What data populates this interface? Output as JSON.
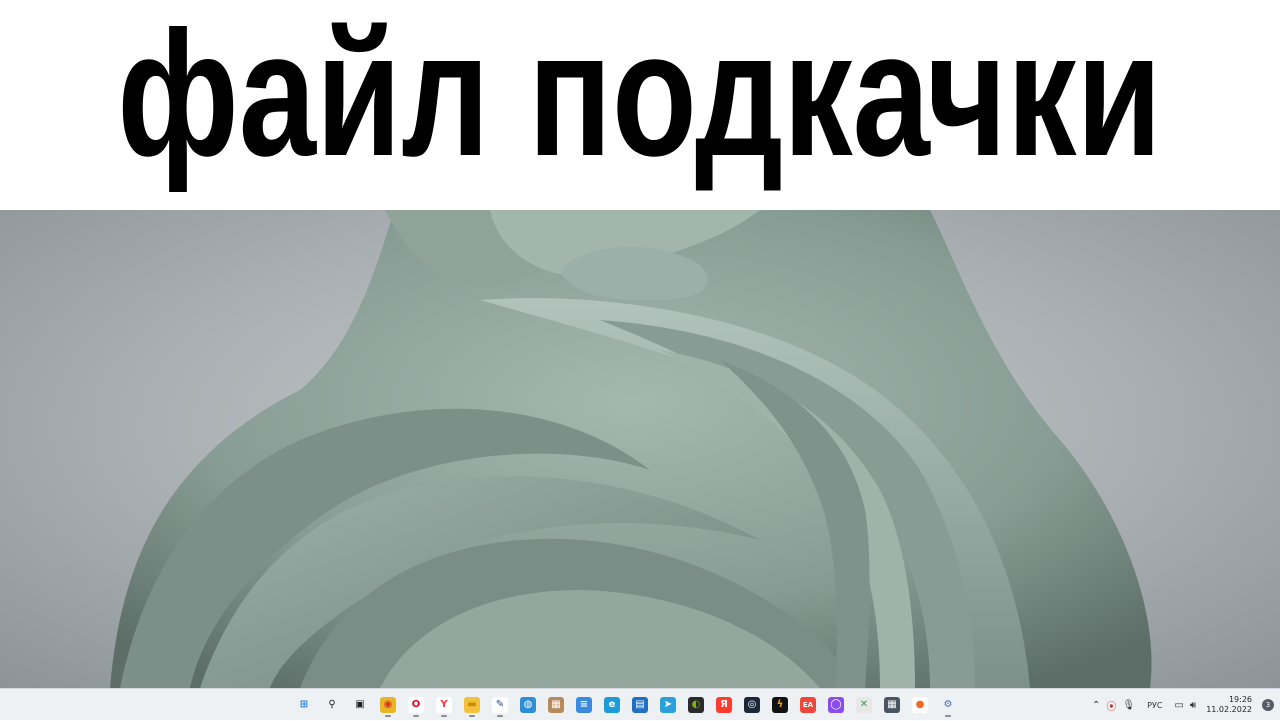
{
  "banner": {
    "title": "файл подкачки"
  },
  "taskbar": {
    "apps": [
      {
        "id": "start-button",
        "icon": "windows-logo",
        "bg": "transparent",
        "glyph": "⊞",
        "color": "#1e7ad8",
        "running": false
      },
      {
        "id": "search-button",
        "icon": "search",
        "bg": "transparent",
        "glyph": "⚲",
        "color": "#202020",
        "running": false
      },
      {
        "id": "task-view-button",
        "icon": "task-view",
        "bg": "transparent",
        "glyph": "▣",
        "color": "#202020",
        "running": false
      },
      {
        "id": "chrome-app",
        "icon": "chrome",
        "bg": "#e9b526",
        "glyph": "◉",
        "color": "#d93025",
        "running": true
      },
      {
        "id": "opera-app",
        "icon": "opera",
        "bg": "#ffffff",
        "glyph": "O",
        "color": "#e0001b",
        "running": true
      },
      {
        "id": "yandex-browser-app",
        "icon": "yandex-browser",
        "bg": "#ffffff",
        "glyph": "Y",
        "color": "#ff3333",
        "running": true
      },
      {
        "id": "file-explorer-app",
        "icon": "folder",
        "bg": "#f3c13a",
        "glyph": "▬",
        "color": "#c98e00",
        "running": true
      },
      {
        "id": "notepad-app",
        "icon": "notepad-pen",
        "bg": "#ffffff",
        "glyph": "✎",
        "color": "#1a4d8f",
        "running": true
      },
      {
        "id": "network-app",
        "icon": "globe",
        "bg": "#2e8fd6",
        "glyph": "◍",
        "color": "#ffffff",
        "running": false
      },
      {
        "id": "installer-app",
        "icon": "package",
        "bg": "#b78a5c",
        "glyph": "▦",
        "color": "#ffffff",
        "running": false
      },
      {
        "id": "notes-app",
        "icon": "notes",
        "bg": "#3a8be0",
        "glyph": "≡",
        "color": "#ffffff",
        "running": false
      },
      {
        "id": "edge-app",
        "icon": "edge",
        "bg": "#1c9bd8",
        "glyph": "e",
        "color": "#ffffff",
        "running": false
      },
      {
        "id": "store-app",
        "icon": "store-bag",
        "bg": "#1f6fc4",
        "glyph": "▤",
        "color": "#ffffff",
        "running": false
      },
      {
        "id": "telegram-app",
        "icon": "telegram-plane",
        "bg": "#2aa1da",
        "glyph": "➤",
        "color": "#ffffff",
        "running": false
      },
      {
        "id": "nvidia-app",
        "icon": "nvidia",
        "bg": "#2b2b2b",
        "glyph": "◐",
        "color": "#76b900",
        "running": false
      },
      {
        "id": "yandex-app",
        "icon": "yandex",
        "bg": "#ff3b30",
        "glyph": "Я",
        "color": "#ffffff",
        "running": false
      },
      {
        "id": "steam-app",
        "icon": "steam",
        "bg": "#1b2838",
        "glyph": "◎",
        "color": "#ffffff",
        "running": false
      },
      {
        "id": "game-app",
        "icon": "game-bolt",
        "bg": "#111111",
        "glyph": "ϟ",
        "color": "#f4a21c",
        "running": false
      },
      {
        "id": "ea-app",
        "icon": "ea",
        "bg": "#f0463c",
        "glyph": "EA",
        "color": "#ffffff",
        "running": false
      },
      {
        "id": "alice-app",
        "icon": "alice",
        "bg": "#8a4cf0",
        "glyph": "◯",
        "color": "#ffffff",
        "running": false
      },
      {
        "id": "xbox-app",
        "icon": "xbox",
        "bg": "#e8e8e8",
        "glyph": "✕",
        "color": "#2f9e44",
        "running": false
      },
      {
        "id": "calculator-app",
        "icon": "calculator",
        "bg": "#4a5563",
        "glyph": "▦",
        "color": "#ffffff",
        "running": false
      },
      {
        "id": "maps-app",
        "icon": "map-pin",
        "bg": "#ffffff",
        "glyph": "●",
        "color": "#f26722",
        "running": false
      },
      {
        "id": "settings-app",
        "icon": "gear",
        "bg": "transparent",
        "glyph": "⚙",
        "color": "#3b6fb0",
        "running": true
      }
    ]
  },
  "tray": {
    "chevron_icon": "chevron-up",
    "lang": "РУС",
    "time": "19:26",
    "date": "11.02.2022",
    "notification_count": "3"
  }
}
